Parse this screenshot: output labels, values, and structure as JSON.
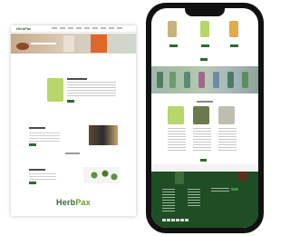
{
  "desktop": {
    "nav_logo": "HerbPax",
    "footer_logo_main": "Herb",
    "footer_logo_accent": "Pax"
  },
  "colors": {
    "brand_green": "#2f6a32",
    "footer_green": "#1f4d24",
    "accent_lime": "#6a9b2a"
  }
}
